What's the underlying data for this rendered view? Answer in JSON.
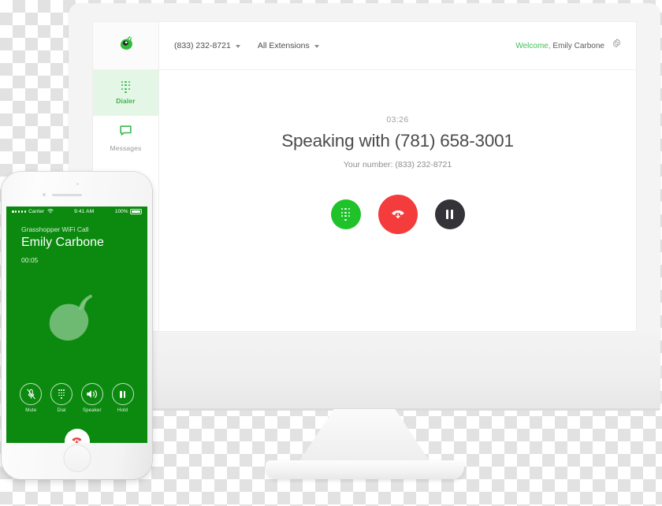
{
  "desktop_app": {
    "logo_icon": "grasshopper-logo",
    "sidebar": {
      "items": [
        {
          "label": "Dialer",
          "icon": "dialpad-icon",
          "active": true
        },
        {
          "label": "Messages",
          "icon": "message-icon",
          "active": false
        }
      ]
    },
    "topbar": {
      "phone_selector": "(833) 232-8721",
      "extension_selector": "All Extensions",
      "welcome_prefix": "Welcome,",
      "user_name": "Emily Carbone",
      "settings_icon": "gear-icon"
    },
    "call": {
      "timer": "03:26",
      "title": "Speaking with (781) 658-3001",
      "your_number": "Your number: (833) 232-8721",
      "controls": [
        {
          "name": "dialpad-button",
          "icon": "dialpad-icon",
          "color": "#1fc229"
        },
        {
          "name": "hangup-button",
          "icon": "phone-down-icon",
          "color": "#f43c3c"
        },
        {
          "name": "hold-button",
          "icon": "pause-icon",
          "color": "#333338"
        }
      ]
    }
  },
  "phone_app": {
    "status_bar": {
      "carrier": "Carrier",
      "signal_icon": "signal-dots-icon",
      "wifi_icon": "wifi-icon",
      "time": "9:41 AM",
      "battery_percent": "100%",
      "battery_icon": "battery-full-icon"
    },
    "call": {
      "service": "Grasshopper WiFi Call",
      "caller_name": "Emily Carbone",
      "duration": "00:05",
      "hero_icon": "grasshopper-logo",
      "actions": [
        {
          "label": "Mute",
          "icon": "mic-muted-icon"
        },
        {
          "label": "Dial",
          "icon": "dialpad-icon"
        },
        {
          "label": "Speaker",
          "icon": "speaker-icon"
        },
        {
          "label": "Hold",
          "icon": "pause-icon"
        }
      ],
      "end_call_icon": "phone-down-icon"
    }
  },
  "colors": {
    "brand_green": "#3cb44a",
    "phone_screen_green": "#0b8a0f",
    "dialpad_green": "#1fc229",
    "hangup_red": "#f43c3c",
    "hold_dark": "#333338"
  }
}
